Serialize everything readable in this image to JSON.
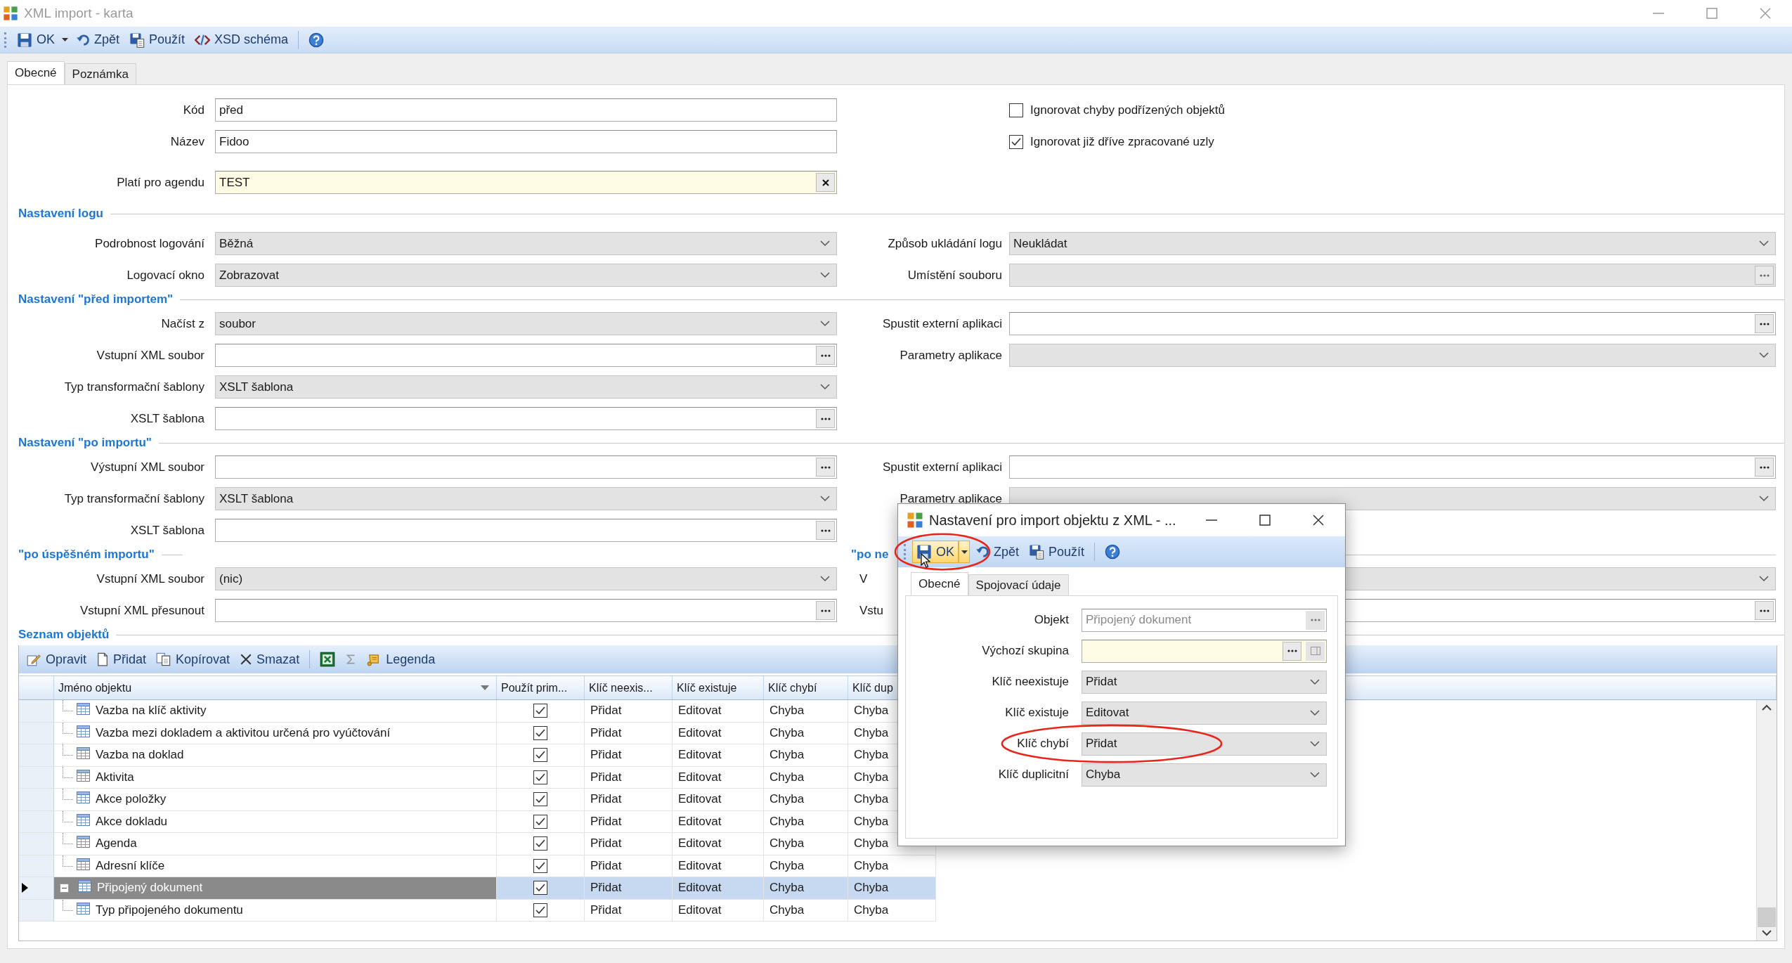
{
  "window": {
    "title": "XML import - karta"
  },
  "toolbar": [
    {
      "kind": "save",
      "label": "OK",
      "split": true
    },
    {
      "kind": "undo",
      "label": "Zpět",
      "split": false
    },
    {
      "kind": "apply",
      "label": "Použít",
      "split": false
    },
    {
      "kind": "schema",
      "label": "XSD schéma",
      "split": false
    },
    {
      "kind": "help",
      "split": false
    }
  ],
  "tabs": [
    {
      "label": "Obecné",
      "selected": true
    },
    {
      "label": "Poznámka",
      "selected": false
    }
  ],
  "general": {
    "fields": [
      {
        "label": "Kód",
        "value": "před",
        "kind": "text"
      },
      {
        "label": "Název",
        "value": "Fidoo",
        "kind": "text"
      },
      {
        "label": "Platí pro agendu",
        "value": "TEST",
        "kind": "lookup"
      }
    ],
    "checkboxes": [
      {
        "label": "Ignorovat chyby podřízených objektů",
        "checked": false
      },
      {
        "label": "Ignorovat již dříve zpracované uzly",
        "checked": true
      }
    ]
  },
  "sections": [
    {
      "title": "Nastavení logu",
      "fields": [
        {
          "label": "Podrobnost logování",
          "value": "Běžná",
          "kind": "select"
        },
        {
          "label": "Logovací okno",
          "value": "Zobrazovat",
          "kind": "select"
        }
      ],
      "right_fields": [
        {
          "label": "Způsob ukládání logu",
          "value": "Neukládat",
          "kind": "select"
        },
        {
          "label": "Umístění souboru",
          "kind": "readonly-browse"
        }
      ]
    },
    {
      "title": "Nastavení \"před importem\"",
      "fields": [
        {
          "label": "Načíst z",
          "value": "soubor",
          "kind": "select"
        },
        {
          "label": "Vstupní XML soubor",
          "kind": "browse"
        },
        {
          "label": "Typ transformační šablony",
          "value": "XSLT šablona",
          "kind": "select"
        },
        {
          "label": "XSLT šablona",
          "kind": "browse"
        }
      ],
      "right_fields": [
        {
          "label": "Spustit externí aplikaci",
          "kind": "browse"
        },
        {
          "label": "Parametry aplikace",
          "kind": "select"
        }
      ]
    },
    {
      "title": "Nastavení \"po importu\"",
      "fields": [
        {
          "label": "Výstupní XML soubor",
          "kind": "browse"
        },
        {
          "label": "Typ transformační šablony",
          "value": "XSLT šablona",
          "kind": "select"
        },
        {
          "label": "XSLT šablona",
          "kind": "browse"
        }
      ],
      "right_fields": [
        {
          "label": "Spustit externí aplikaci",
          "kind": "browse"
        },
        {
          "label": "Parametry aplikace",
          "kind": "select"
        }
      ]
    },
    {
      "title": "\"po úspěšném importu\"",
      "right_title": "\"po ne",
      "fields": [
        {
          "label": "Vstupní XML soubor",
          "value": "(nic)",
          "kind": "select"
        },
        {
          "label": "Vstupní XML přesunout",
          "kind": "browse"
        }
      ],
      "right_fields": [
        {
          "label": "V",
          "kind": "select"
        },
        {
          "label": "Vstu",
          "kind": "browse"
        }
      ]
    }
  ],
  "objects": {
    "title": "Seznam objektů",
    "toolbar": [
      {
        "kind": "edit",
        "label": "Opravit"
      },
      {
        "kind": "add",
        "label": "Přidat"
      },
      {
        "kind": "copy",
        "label": "Kopírovat"
      },
      {
        "kind": "delete",
        "label": "Smazat"
      },
      {
        "kind": "excel"
      },
      {
        "kind": "sum"
      },
      {
        "kind": "legend",
        "label": "Legenda"
      }
    ],
    "columns": [
      "Jméno objektu",
      "Použít prim...",
      "Klíč neexis...",
      "Klíč existuje",
      "Klíč chybí",
      "Klíč dup"
    ],
    "rows": [
      {
        "children": [
          {
            "name": "Vazba na klíč aktivity",
            "checked": true,
            "selected": false,
            "cells": [
              "Přidat",
              "Editovat",
              "Chyba",
              "Chyba"
            ]
          },
          {
            "name": "Vazba mezi dokladem a aktivitou určená pro vyúčtování",
            "checked": true,
            "selected": false,
            "cells": [
              "Přidat",
              "Editovat",
              "Chyba",
              "Chyba"
            ]
          },
          {
            "name": "Vazba na doklad",
            "checked": true,
            "selected": false,
            "cells": [
              "Přidat",
              "Editovat",
              "Chyba",
              "Chyba"
            ]
          },
          {
            "name": "Aktivita",
            "checked": true,
            "selected": false,
            "cells": [
              "Přidat",
              "Editovat",
              "Chyba",
              "Chyba"
            ]
          },
          {
            "name": "Akce položky",
            "checked": true,
            "selected": false,
            "cells": [
              "Přidat",
              "Editovat",
              "Chyba",
              "Chyba"
            ]
          },
          {
            "name": "Akce dokladu",
            "checked": true,
            "selected": false,
            "cells": [
              "Přidat",
              "Editovat",
              "Chyba",
              "Chyba"
            ]
          },
          {
            "name": "Agenda",
            "checked": true,
            "selected": false,
            "cells": [
              "Přidat",
              "Editovat",
              "Chyba",
              "Chyba"
            ]
          },
          {
            "name": "Adresní klíče",
            "checked": true,
            "selected": false,
            "cells": [
              "Přidat",
              "Editovat",
              "Chyba",
              "Chyba"
            ]
          }
        ]
      },
      {
        "name": "Připojený dokument",
        "checked": true,
        "selected": true,
        "expanded": true,
        "cells": [
          "Přidat",
          "Editovat",
          "Chyba",
          "Chyba"
        ],
        "children": [
          {
            "name": "Typ připojeného dokumentu",
            "checked": true,
            "selected": false,
            "cells": [
              "Přidat",
              "Editovat",
              "Chyba",
              "Chyba"
            ]
          }
        ]
      }
    ]
  },
  "dialog": {
    "title": "Nastavení pro import objektu z XML - ...",
    "toolbar": [
      {
        "kind": "save",
        "label": "OK",
        "split": true,
        "hovered": true,
        "annotated": true
      },
      {
        "kind": "undo",
        "label": "Zpět",
        "split": false,
        "hovered": false,
        "annotated": false
      },
      {
        "kind": "apply",
        "label": "Použít",
        "split": false,
        "hovered": false,
        "annotated": false
      },
      {
        "kind": "help",
        "split": false,
        "hovered": false,
        "annotated": false
      }
    ],
    "tabs": [
      {
        "label": "Obecné",
        "selected": true
      },
      {
        "label": "Spojovací údaje",
        "selected": false
      }
    ],
    "fields": [
      {
        "label": "Objekt",
        "value": "Připojený dokument",
        "kind": "disabled-browse",
        "annotated": false
      },
      {
        "label": "Výchozí skupina",
        "kind": "lookup-browse",
        "annotated": false
      },
      {
        "label": "Klíč neexistuje",
        "value": "Přidat",
        "kind": "select",
        "annotated": false
      },
      {
        "label": "Klíč existuje",
        "value": "Editovat",
        "kind": "select",
        "annotated": false
      },
      {
        "label": "Klíč chybí",
        "value": "Přidat",
        "kind": "select",
        "annotated": true
      },
      {
        "label": "Klíč duplicitní",
        "value": "Chyba",
        "kind": "select",
        "annotated": false
      }
    ]
  }
}
